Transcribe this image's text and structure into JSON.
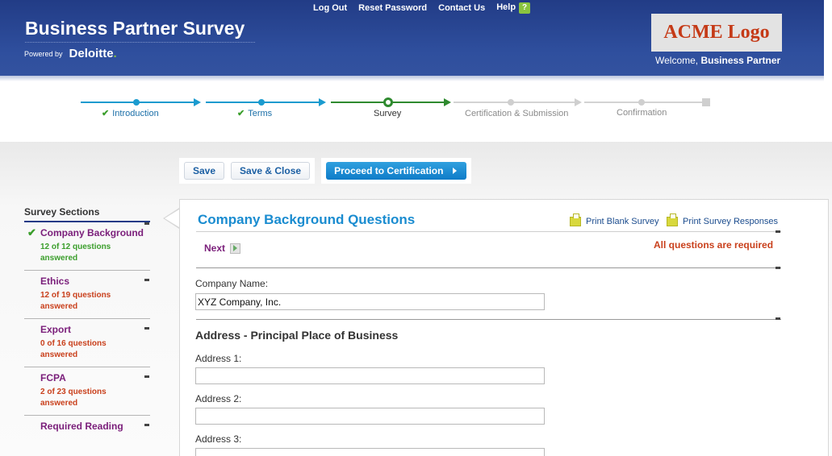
{
  "header": {
    "title": "Business Partner Survey",
    "powered_by": "Powered by",
    "brand_main": "Deloitte",
    "brand_dot": ".",
    "links": [
      "Log Out",
      "Reset Password",
      "Contact Us",
      "Help"
    ],
    "help_icon_glyph": "?",
    "logo_text": "ACME Logo",
    "welcome_prefix": "Welcome,",
    "welcome_user": "Business Partner"
  },
  "stepper": {
    "steps": [
      {
        "label": "Introduction",
        "state": "done"
      },
      {
        "label": "Terms",
        "state": "done"
      },
      {
        "label": "Survey",
        "state": "current"
      },
      {
        "label": "Certification & Submission",
        "state": "upcoming"
      },
      {
        "label": "Confirmation",
        "state": "upcoming"
      }
    ],
    "check_glyph": "✔"
  },
  "toolbar": {
    "save_label": "Save",
    "save_close_label": "Save & Close",
    "proceed_label": "Proceed to Certification"
  },
  "sidebar": {
    "title": "Survey Sections",
    "items": [
      {
        "label": "Company Background",
        "count": "12 of 12 questions",
        "count2": "answered",
        "complete": true
      },
      {
        "label": "Ethics",
        "count": "12 of 19 questions",
        "count2": "answered",
        "complete": false
      },
      {
        "label": "Export",
        "count": "0 of 16 questions",
        "count2": "answered",
        "complete": false
      },
      {
        "label": "FCPA",
        "count": "2 of 23 questions",
        "count2": "answered",
        "complete": false
      },
      {
        "label": "Required Reading",
        "count": "",
        "count2": "",
        "complete": false
      }
    ]
  },
  "main": {
    "title": "Company Background Questions",
    "print_blank": "Print Blank Survey",
    "print_responses": "Print Survey Responses",
    "next_label": "Next",
    "required_note": "All questions are required",
    "company_name_label": "Company Name:",
    "company_name_value": "XYZ Company, Inc.",
    "address_heading": "Address - Principal Place of Business",
    "address1_label": "Address 1:",
    "address1_value": "",
    "address2_label": "Address 2:",
    "address2_value": "",
    "address3_label": "Address 3:",
    "address3_value": ""
  },
  "colors": {
    "header_blue": "#2a4896",
    "accent_blue": "#1a8cd0",
    "done_teal": "#1b9bcf",
    "current_green": "#2f8a2f",
    "section_purple": "#7a1e7a",
    "complete_green": "#3a9e2b",
    "incomplete_orange": "#c9401c"
  }
}
